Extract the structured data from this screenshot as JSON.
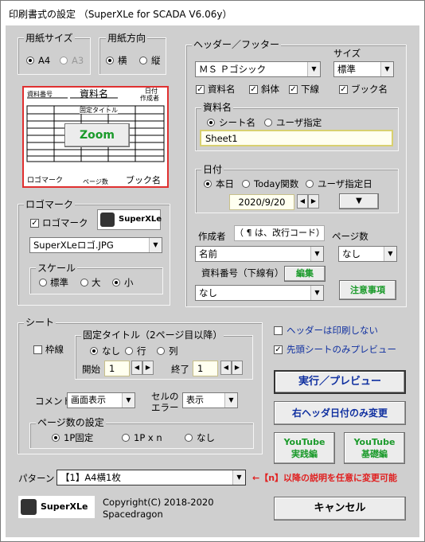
{
  "window": {
    "title": "印刷書式の設定 （SuperXLe for SCADA V6.06y）"
  },
  "paper_size": {
    "label": "用紙サイズ",
    "options": [
      "A4",
      "A3"
    ],
    "selected": "A4"
  },
  "paper_orient": {
    "label": "用紙方向",
    "options": [
      "横",
      "縦"
    ],
    "selected": "横"
  },
  "preview": {
    "doc_number": "資料番号",
    "doc_name": "資料名",
    "date_line1": "日付",
    "date_line2": "作成者",
    "fixed_title": "固定タイトル",
    "zoom": "Zoom",
    "logo_mark": "ロゴマーク",
    "page_count": "ページ数",
    "book_name": "ブック名"
  },
  "logo": {
    "group_label": "ロゴマーク",
    "check_label": "ロゴマーク",
    "checked": true,
    "image_text": "SuperXLe",
    "file": "SuperXLeロゴ.JPG",
    "scale_label": "スケール",
    "scale_options": [
      "標準",
      "大",
      "小"
    ],
    "scale_selected": "小"
  },
  "header_footer": {
    "group_label": "ヘッダー／フッター",
    "font": "ＭＳ Ｐゴシック",
    "size_label": "サイズ",
    "size": "標準",
    "checks": [
      {
        "label": "資料名",
        "checked": true
      },
      {
        "label": "斜体",
        "checked": true
      },
      {
        "label": "下線",
        "checked": true
      },
      {
        "label": "ブック名",
        "checked": true
      }
    ],
    "doc_name_group": "資料名",
    "doc_name_options": [
      "シート名",
      "ユーザ指定"
    ],
    "doc_name_selected": "シート名",
    "doc_name_value": "Sheet1",
    "date_group": "日付",
    "date_options": [
      "本日",
      "Today関数",
      "ユーザ指定日"
    ],
    "date_selected": "本日",
    "date_value": "2020/9/20",
    "author_label": "作成者",
    "author_note": "（ ¶ は、改行コード）",
    "author_value": "名前",
    "page_label": "ページ数",
    "page_value": "なし",
    "doc_number_label": "資料番号（下線有）",
    "edit_button": "編集",
    "doc_number_value": "なし",
    "notes_button": "注意事項"
  },
  "sheet": {
    "group_label": "シート",
    "frame_label": "枠線",
    "frame_checked": false,
    "fixed_title_group": "固定タイトル（2ページ目以降）",
    "fixed_title_options": [
      "なし",
      "行",
      "列"
    ],
    "fixed_title_selected": "なし",
    "start_label": "開始",
    "start_value": "1",
    "end_label": "終了",
    "end_value": "1",
    "comment_label": "コメント",
    "comment_value": "画面表示",
    "cell_error_line1": "セルの",
    "cell_error_line2": "エラー",
    "cell_error_value": "表示",
    "page_setting_group": "ページ数の設定",
    "page_setting_options": [
      "1P固定",
      "1P x n",
      "なし"
    ],
    "page_setting_selected": "1P固定"
  },
  "right_panel": {
    "no_header_label": "ヘッダーは印刷しない",
    "no_header_checked": false,
    "first_sheet_label": "先頭シートのみプレビュー",
    "first_sheet_checked": true,
    "run_button": "実行／プレビュー",
    "date_only_button": "右ヘッダ日付のみ変更",
    "yt_practice_1": "YouTube",
    "yt_practice_2": "実践編",
    "yt_basic_1": "YouTube",
    "yt_basic_2": "基礎編",
    "cancel_button": "キャンセル"
  },
  "pattern": {
    "label": "パターン",
    "value": "【1】A4横1枚",
    "note": "←【n】以降の説明を任意に変更可能"
  },
  "footer": {
    "logo_text": "SuperXLe",
    "copyright": "Copyright(C) 2018-2020",
    "author": "Spacedragon"
  },
  "colors": {
    "dialog_bg": "#cfcfcf",
    "green_text": "#1a9a2a",
    "blue_text": "#1030a0",
    "red_note": "#e02020",
    "preview_border": "#e03030"
  }
}
